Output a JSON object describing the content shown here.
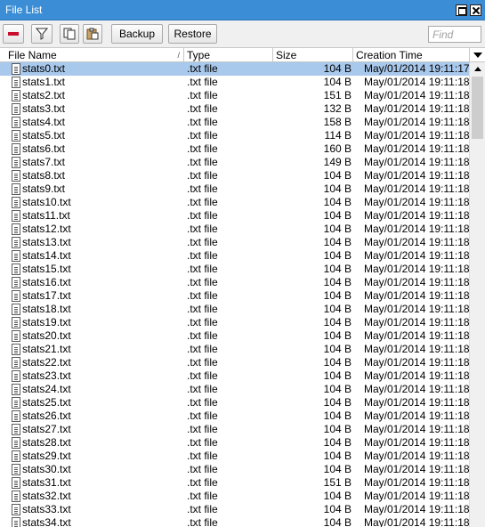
{
  "window": {
    "title": "File List"
  },
  "toolbar": {
    "remove_icon": "remove-icon",
    "filter_icon": "filter-icon",
    "copy_icon": "copy-icon",
    "paste_icon": "paste-icon",
    "backup_label": "Backup",
    "restore_label": "Restore",
    "find_placeholder": "Find"
  },
  "table": {
    "columns": [
      "File Name",
      "Type",
      "Size",
      "Creation Time"
    ],
    "rows": [
      {
        "name": "stats0.txt",
        "type": ".txt file",
        "size": "104 B",
        "time": "May/01/2014 19:11:17"
      },
      {
        "name": "stats1.txt",
        "type": ".txt file",
        "size": "104 B",
        "time": "May/01/2014 19:11:18"
      },
      {
        "name": "stats2.txt",
        "type": ".txt file",
        "size": "151 B",
        "time": "May/01/2014 19:11:18"
      },
      {
        "name": "stats3.txt",
        "type": ".txt file",
        "size": "132 B",
        "time": "May/01/2014 19:11:18"
      },
      {
        "name": "stats4.txt",
        "type": ".txt file",
        "size": "158 B",
        "time": "May/01/2014 19:11:18"
      },
      {
        "name": "stats5.txt",
        "type": ".txt file",
        "size": "114 B",
        "time": "May/01/2014 19:11:18"
      },
      {
        "name": "stats6.txt",
        "type": ".txt file",
        "size": "160 B",
        "time": "May/01/2014 19:11:18"
      },
      {
        "name": "stats7.txt",
        "type": ".txt file",
        "size": "149 B",
        "time": "May/01/2014 19:11:18"
      },
      {
        "name": "stats8.txt",
        "type": ".txt file",
        "size": "104 B",
        "time": "May/01/2014 19:11:18"
      },
      {
        "name": "stats9.txt",
        "type": ".txt file",
        "size": "104 B",
        "time": "May/01/2014 19:11:18"
      },
      {
        "name": "stats10.txt",
        "type": ".txt file",
        "size": "104 B",
        "time": "May/01/2014 19:11:18"
      },
      {
        "name": "stats11.txt",
        "type": ".txt file",
        "size": "104 B",
        "time": "May/01/2014 19:11:18"
      },
      {
        "name": "stats12.txt",
        "type": ".txt file",
        "size": "104 B",
        "time": "May/01/2014 19:11:18"
      },
      {
        "name": "stats13.txt",
        "type": ".txt file",
        "size": "104 B",
        "time": "May/01/2014 19:11:18"
      },
      {
        "name": "stats14.txt",
        "type": ".txt file",
        "size": "104 B",
        "time": "May/01/2014 19:11:18"
      },
      {
        "name": "stats15.txt",
        "type": ".txt file",
        "size": "104 B",
        "time": "May/01/2014 19:11:18"
      },
      {
        "name": "stats16.txt",
        "type": ".txt file",
        "size": "104 B",
        "time": "May/01/2014 19:11:18"
      },
      {
        "name": "stats17.txt",
        "type": ".txt file",
        "size": "104 B",
        "time": "May/01/2014 19:11:18"
      },
      {
        "name": "stats18.txt",
        "type": ".txt file",
        "size": "104 B",
        "time": "May/01/2014 19:11:18"
      },
      {
        "name": "stats19.txt",
        "type": ".txt file",
        "size": "104 B",
        "time": "May/01/2014 19:11:18"
      },
      {
        "name": "stats20.txt",
        "type": ".txt file",
        "size": "104 B",
        "time": "May/01/2014 19:11:18"
      },
      {
        "name": "stats21.txt",
        "type": ".txt file",
        "size": "104 B",
        "time": "May/01/2014 19:11:18"
      },
      {
        "name": "stats22.txt",
        "type": ".txt file",
        "size": "104 B",
        "time": "May/01/2014 19:11:18"
      },
      {
        "name": "stats23.txt",
        "type": ".txt file",
        "size": "104 B",
        "time": "May/01/2014 19:11:18"
      },
      {
        "name": "stats24.txt",
        "type": ".txt file",
        "size": "104 B",
        "time": "May/01/2014 19:11:18"
      },
      {
        "name": "stats25.txt",
        "type": ".txt file",
        "size": "104 B",
        "time": "May/01/2014 19:11:18"
      },
      {
        "name": "stats26.txt",
        "type": ".txt file",
        "size": "104 B",
        "time": "May/01/2014 19:11:18"
      },
      {
        "name": "stats27.txt",
        "type": ".txt file",
        "size": "104 B",
        "time": "May/01/2014 19:11:18"
      },
      {
        "name": "stats28.txt",
        "type": ".txt file",
        "size": "104 B",
        "time": "May/01/2014 19:11:18"
      },
      {
        "name": "stats29.txt",
        "type": ".txt file",
        "size": "104 B",
        "time": "May/01/2014 19:11:18"
      },
      {
        "name": "stats30.txt",
        "type": ".txt file",
        "size": "104 B",
        "time": "May/01/2014 19:11:18"
      },
      {
        "name": "stats31.txt",
        "type": ".txt file",
        "size": "151 B",
        "time": "May/01/2014 19:11:18"
      },
      {
        "name": "stats32.txt",
        "type": ".txt file",
        "size": "104 B",
        "time": "May/01/2014 19:11:18"
      },
      {
        "name": "stats33.txt",
        "type": ".txt file",
        "size": "104 B",
        "time": "May/01/2014 19:11:18"
      },
      {
        "name": "stats34.txt",
        "type": ".txt file",
        "size": "104 B",
        "time": "May/01/2014 19:11:18"
      }
    ],
    "selected_index": 0
  },
  "colors": {
    "titlebar": "#3b8ed6",
    "selection": "#a8c8ec",
    "remove": "#c8102e"
  }
}
